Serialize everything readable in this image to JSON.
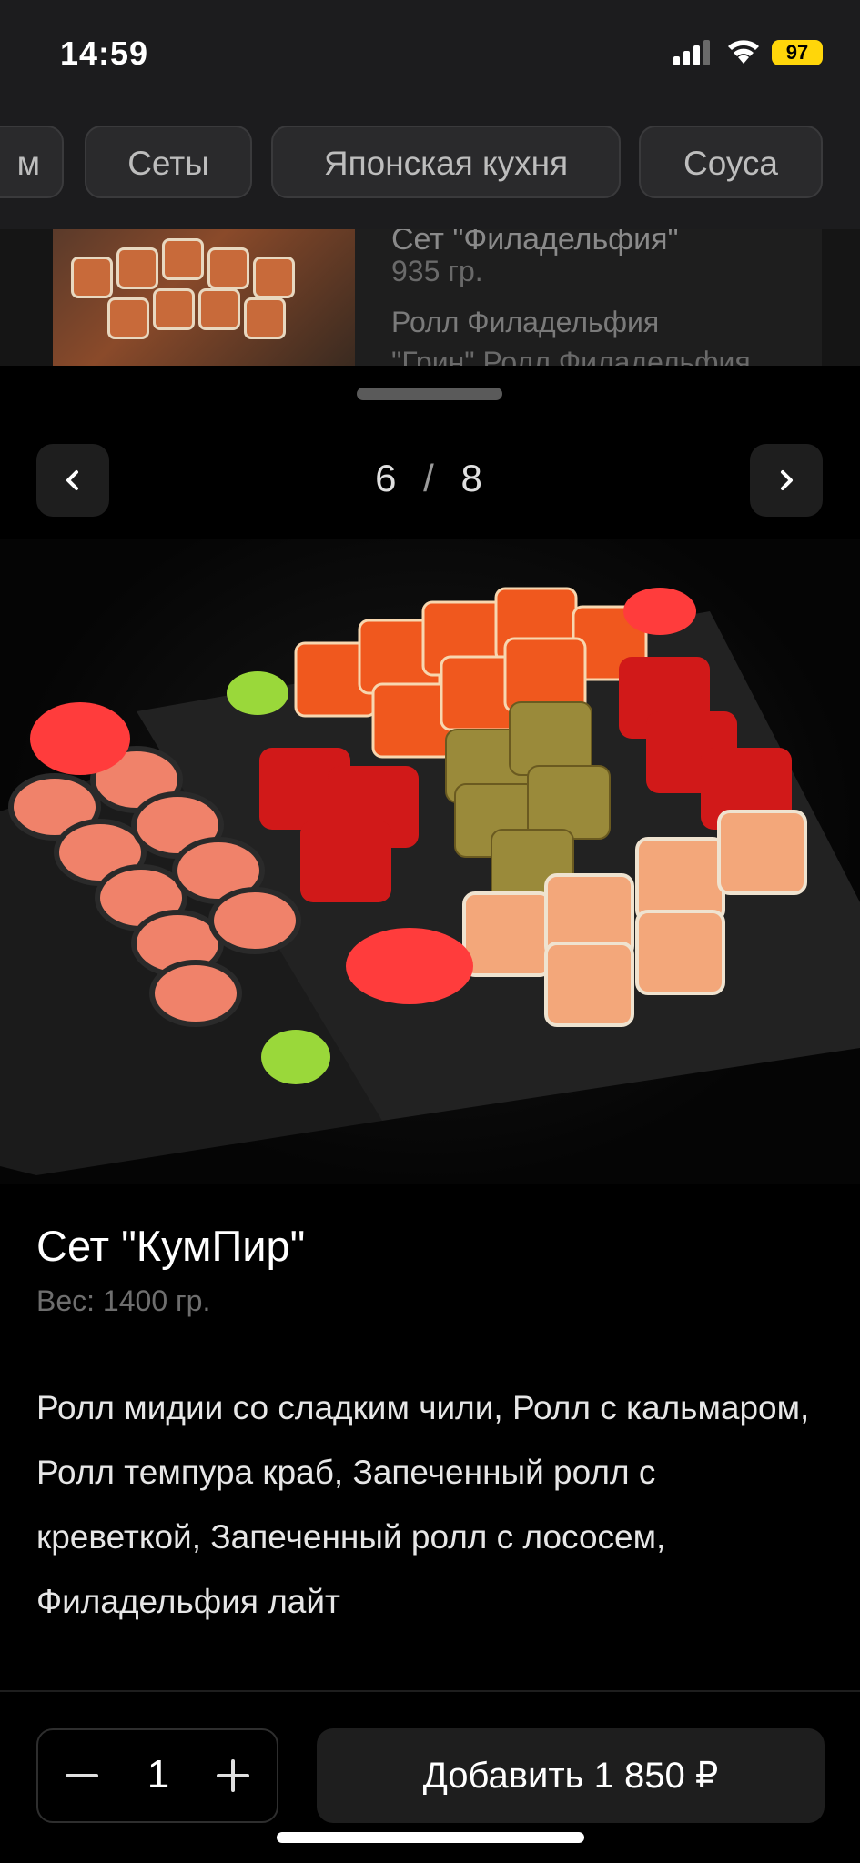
{
  "status_bar": {
    "time": "14:59",
    "battery": "97",
    "battery_color": "#ffd60a"
  },
  "categories": {
    "chips": [
      {
        "label": "м"
      },
      {
        "label": "Сеты"
      },
      {
        "label": "Японская кухня"
      },
      {
        "label": "Соуса"
      }
    ]
  },
  "background_item": {
    "title": "Сет \"Филадельфия\"",
    "weight": "935 гр.",
    "desc_line1": "Ролл Филадельфия",
    "desc_line2": "\"Грин\" Ролл Филадельфия"
  },
  "product": {
    "pager": {
      "current": "6",
      "separator": "/",
      "total": "8"
    },
    "title": "Сет \"КумПир\"",
    "weight": "Вес: 1400 гр.",
    "description": "Ролл мидии со сладким чили, Ролл с кальмаром, Ролл темпура краб, Запеченный ролл с креветкой, Запеченный ролл с лососем, Филадельфия лайт"
  },
  "footer": {
    "quantity": "1",
    "add_button_label": "Добавить 1 850 ₽"
  },
  "icons": {
    "prev": "chevron-left-icon",
    "next": "chevron-right-icon",
    "minus": "minus-icon",
    "plus": "plus-icon"
  }
}
